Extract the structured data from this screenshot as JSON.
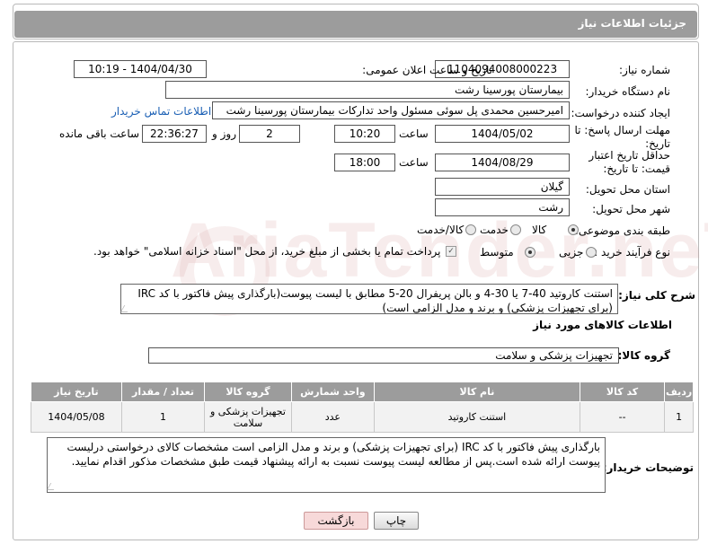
{
  "header": {
    "title": "جزئیات اطلاعات نیاز"
  },
  "fields": {
    "need_number_label": "شماره نیاز:",
    "need_number": "1104094008000223",
    "announce_label": "تاریخ و ساعت اعلان عمومی:",
    "announce_value": "1404/04/30 - 10:19",
    "buyer_org_label": "نام دستگاه خریدار:",
    "buyer_org": "بیمارستان پورسینا رشت",
    "creator_label": "ایجاد کننده درخواست:",
    "creator": "امیرحسین محمدی پل سوئی مسئول واحد تدارکات بیمارستان پورسینا رشت",
    "contact_link": "اطلاعات تماس خریدار",
    "reply_deadline_label": "مهلت ارسال پاسخ: تا تاریخ:",
    "reply_date": "1404/05/02",
    "time_label": "ساعت",
    "reply_time": "10:20",
    "days_value": "2",
    "days_label": "روز و",
    "remaining_value": "22:36:27",
    "remaining_label": "ساعت باقی مانده",
    "price_validity_label": "حداقل تاریخ اعتبار قیمت: تا تاریخ:",
    "price_date": "1404/08/29",
    "price_time": "18:00",
    "province_label": "استان محل تحویل:",
    "province": "گیلان",
    "city_label": "شهر محل تحویل:",
    "city": "رشت",
    "category_label": "طبقه بندی موضوعی:",
    "category_options": [
      "کالا",
      "خدمت",
      "کالا/خدمت"
    ],
    "process_label": "نوع فرآیند خرید :",
    "process_options": [
      "جزیی",
      "متوسط"
    ],
    "payment_note": "پرداخت تمام یا بخشی از مبلغ خرید، از محل \"اسناد خزانه اسلامی\" خواهد بود."
  },
  "description": {
    "label": "شرح کلی نیاز:",
    "text": "استنت کاروتید 40-7 یا 30-4 و بالن پریفرال 20-5 مطابق با لیست پیوست(بارگذاری پیش فاکتور با کد IRC (برای تجهیزات پزشکی) و برند و مدل الزامی است)"
  },
  "goods_section": {
    "title": "اطلاعات کالاهای مورد نیاز",
    "group_label": "گروه کالا:",
    "group_value": "تجهیزات پزشکی و سلامت"
  },
  "table": {
    "headers": [
      "ردیف",
      "کد کالا",
      "نام کالا",
      "واحد شمارش",
      "گروه کالا",
      "تعداد / مقدار",
      "تاریخ نیاز"
    ],
    "rows": [
      [
        "1",
        "--",
        "استنت کاروتید",
        "عدد",
        "تجهیزات پزشکی و سلامت",
        "1",
        "1404/05/08"
      ]
    ]
  },
  "buyer_notes": {
    "label": "توضیحات خریدار:",
    "text": "بارگذاری پیش فاکتور با کد IRC (برای تجهیزات پزشکی) و برند و مدل الزامی است مشخصات کالای درخواستی درلیست پیوست ارائه شده است.پس از مطالعه لیست پیوست نسبت به ارائه پیشنهاد قیمت طبق مشخصات مذکور اقدام نمایید."
  },
  "buttons": {
    "print": "چاپ",
    "back": "بازگشت"
  },
  "watermark": "AriaTender.neT",
  "colors": {
    "header_bg": "#9c9c9c",
    "link": "#1a5fb4",
    "back_btn_bg": "#f7d9d9"
  }
}
